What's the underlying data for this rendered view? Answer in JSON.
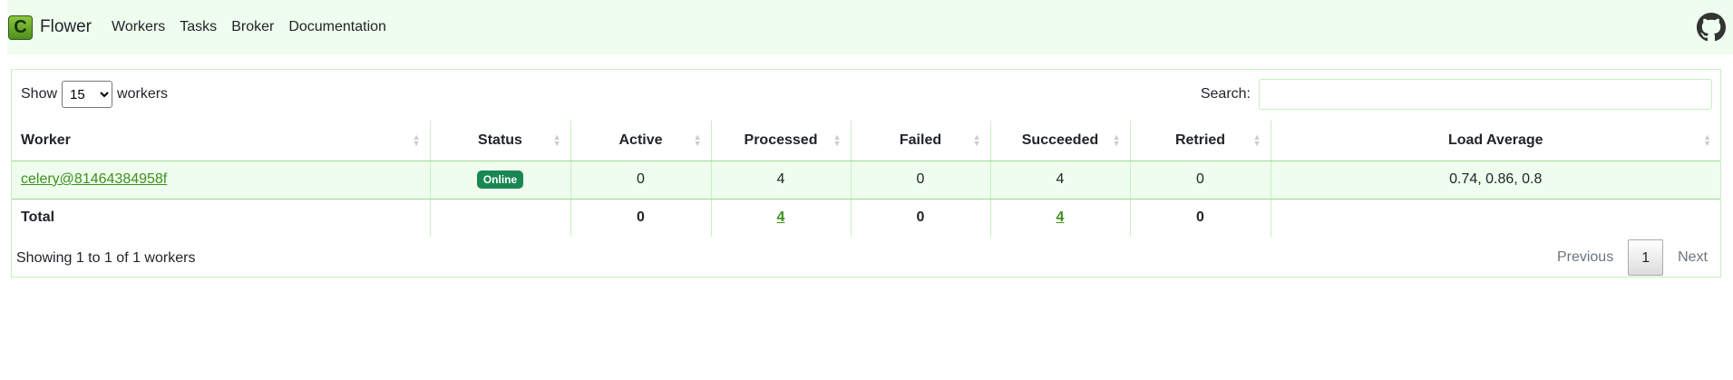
{
  "nav": {
    "brand": "Flower",
    "links": [
      "Workers",
      "Tasks",
      "Broker",
      "Documentation"
    ]
  },
  "controls": {
    "show_label": "Show",
    "show_value": "15",
    "show_suffix": "workers",
    "search_label": "Search:",
    "search_value": ""
  },
  "table": {
    "columns": [
      "Worker",
      "Status",
      "Active",
      "Processed",
      "Failed",
      "Succeeded",
      "Retried",
      "Load Average"
    ],
    "rows": [
      {
        "worker": "celery@81464384958f",
        "status": "Online",
        "active": "0",
        "processed": "4",
        "failed": "0",
        "succeeded": "4",
        "retried": "0",
        "load_average": "0.74, 0.86, 0.8"
      }
    ],
    "total": {
      "label": "Total",
      "active": "0",
      "processed": "4",
      "failed": "0",
      "succeeded": "4",
      "retried": "0"
    }
  },
  "footer": {
    "info": "Showing 1 to 1 of 1 workers",
    "previous": "Previous",
    "page": "1",
    "next": "Next"
  },
  "colors": {
    "accent": "#3f8f1e",
    "status_online": "#198754",
    "navbar_bg": "#eefded"
  },
  "icons": {
    "brand": "celery-logo-icon",
    "github": "github-icon"
  }
}
